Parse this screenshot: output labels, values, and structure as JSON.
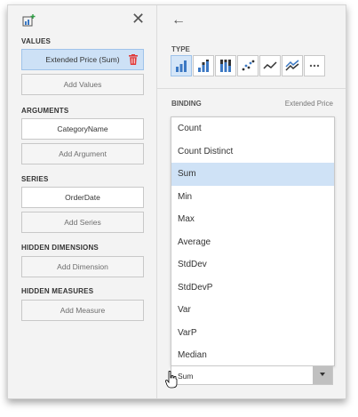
{
  "left": {
    "values_header": "VALUES",
    "values_item": "Extended Price (Sum)",
    "add_values": "Add Values",
    "arguments_header": "ARGUMENTS",
    "arguments_item": "CategoryName",
    "add_argument": "Add Argument",
    "series_header": "SERIES",
    "series_item": "OrderDate",
    "add_series": "Add Series",
    "hidden_dimensions_header": "HIDDEN DIMENSIONS",
    "add_dimension": "Add Dimension",
    "hidden_measures_header": "HIDDEN MEASURES",
    "add_measure": "Add Measure"
  },
  "right": {
    "type_label": "TYPE",
    "type_buttons": [
      "bar-chart-icon",
      "stacked-bar-icon",
      "full-stacked-bar-icon",
      "point-chart-icon",
      "line-chart-icon",
      "area-chart-icon",
      "more-icon"
    ],
    "binding_label": "BINDING",
    "binding_value": "Extended Price",
    "options": [
      "Count",
      "Count Distinct",
      "Sum",
      "Min",
      "Max",
      "Average",
      "StdDev",
      "StdDevP",
      "Var",
      "VarP",
      "Median"
    ],
    "selected_option": "Sum",
    "combo_value": "Sum"
  },
  "colors": {
    "accent_blue": "#3b78c3",
    "selected_bg": "#cde1f6",
    "trash_red": "#e03a3a"
  }
}
